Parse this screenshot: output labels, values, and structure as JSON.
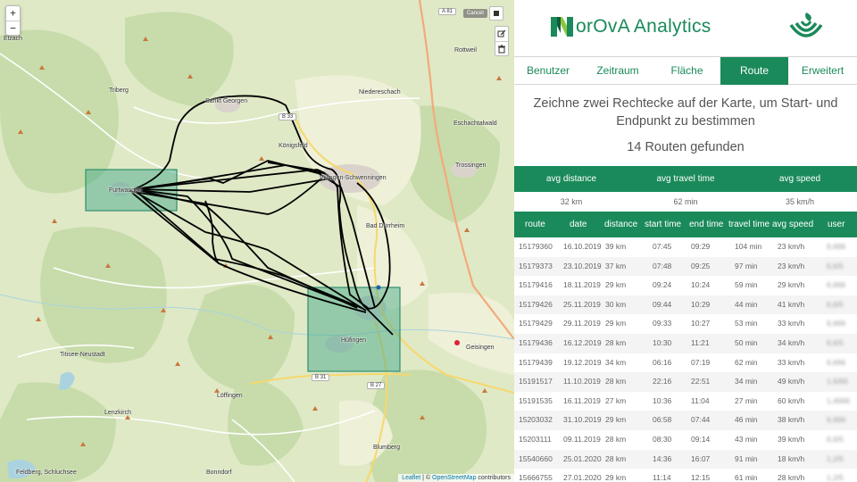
{
  "map": {
    "zoom_in": "+",
    "zoom_out": "−",
    "cancel_label": "Cancel",
    "stop_icon": "stop-square-icon",
    "edit_icon": "edit-icon",
    "delete_icon": "trash-icon",
    "labels": {
      "elzach": "Elzach",
      "triberg": "Triberg",
      "sankt_georgen": "Sankt Georgen",
      "niedereschach": "Niedereschach",
      "rottweil": "Rottweil",
      "trossingen": "Trossingen",
      "bad_durrheim": "Bad Dürrheim",
      "hufingen": "Hüfingen",
      "geisingen": "Geisingen",
      "titisee": "Titisee-Neustadt",
      "lofflingen": "Löffingen",
      "lenzkirch": "Lenzkirch",
      "blumberg": "Blumberg",
      "bonndorf": "Bonndorf",
      "feldberg": "Feldberg, Schluchsee",
      "furtwangen": "Furtwangen",
      "villingen": "Villingen-Schwenningen",
      "konigsfeld": "Königsfeld",
      "eschachtalwald": "Eschachtalwald"
    },
    "roads": {
      "a81": "A 81",
      "b33": "B 33",
      "b31": "B 31",
      "b27": "B 27"
    },
    "attribution_leaflet": "Leaflet",
    "attribution_sep": " | © ",
    "attribution_osm": "OpenStreetMap",
    "attribution_tail": " contributors"
  },
  "brand": {
    "title": "orOvA Analytics",
    "logo_icon": "norova-n-logo-icon",
    "right_logo_icon": "org-logo-icon"
  },
  "tabs": [
    "Benutzer",
    "Zeitraum",
    "Fläche",
    "Route",
    "Erweitert"
  ],
  "active_tab": "Route",
  "instructions": "Zeichne zwei Rechtecke auf der Karte, um Start- und Endpunkt zu bestimmen",
  "routes_found": "14 Routen gefunden",
  "summary": {
    "headers": [
      "avg distance",
      "avg travel time",
      "avg speed"
    ],
    "values": [
      "32 km",
      "62 min",
      "35 km/h"
    ]
  },
  "table": {
    "headers": [
      "route",
      "date",
      "distance",
      "start time",
      "end time",
      "travel time",
      "avg speed",
      "user"
    ],
    "rows": [
      [
        "15179360",
        "16.10.2019",
        "39 km",
        "07:45",
        "09:29",
        "104 min",
        "23 km/h",
        "6,666"
      ],
      [
        "15179373",
        "23.10.2019",
        "37 km",
        "07:48",
        "09:25",
        "97 min",
        "23 km/h",
        "6,6/5"
      ],
      [
        "15179416",
        "18.11.2019",
        "29 km",
        "09:24",
        "10:24",
        "59 min",
        "29 km/h",
        "6,666"
      ],
      [
        "15179426",
        "25.11.2019",
        "30 km",
        "09:44",
        "10:29",
        "44 min",
        "41 km/h",
        "6,6/5"
      ],
      [
        "15179429",
        "29.11.2019",
        "29 km",
        "09:33",
        "10:27",
        "53 min",
        "33 km/h",
        "6,666"
      ],
      [
        "15179436",
        "16.12.2019",
        "28 km",
        "10:30",
        "11:21",
        "50 min",
        "34 km/h",
        "6,6/5"
      ],
      [
        "15179439",
        "19.12.2019",
        "34 km",
        "06:16",
        "07:19",
        "62 min",
        "33 km/h",
        "6,666"
      ],
      [
        "15191517",
        "11.10.2019",
        "28 km",
        "22:16",
        "22:51",
        "34 min",
        "49 km/h",
        "1,6/66"
      ],
      [
        "15191535",
        "16.11.2019",
        "27 km",
        "10:36",
        "11:04",
        "27 min",
        "60 km/h",
        "1,4666"
      ],
      [
        "15203032",
        "31.10.2019",
        "29 km",
        "06:58",
        "07:44",
        "46 min",
        "38 km/h",
        "6,666"
      ],
      [
        "15203111",
        "09.11.2019",
        "28 km",
        "08:30",
        "09:14",
        "43 min",
        "39 km/h",
        "6,6/5"
      ],
      [
        "15540660",
        "25.01.2020",
        "28 km",
        "14:36",
        "16:07",
        "91 min",
        "18 km/h",
        "1,2/5"
      ],
      [
        "15666755",
        "27.01.2020",
        "29 km",
        "11:14",
        "12:15",
        "61 min",
        "28 km/h",
        "1,2/5"
      ]
    ]
  },
  "colors": {
    "brand_green": "#1a8a5a",
    "route_line": "#000000",
    "selection_fill": "#3aa584",
    "map_bg": "#dfe9c6"
  }
}
